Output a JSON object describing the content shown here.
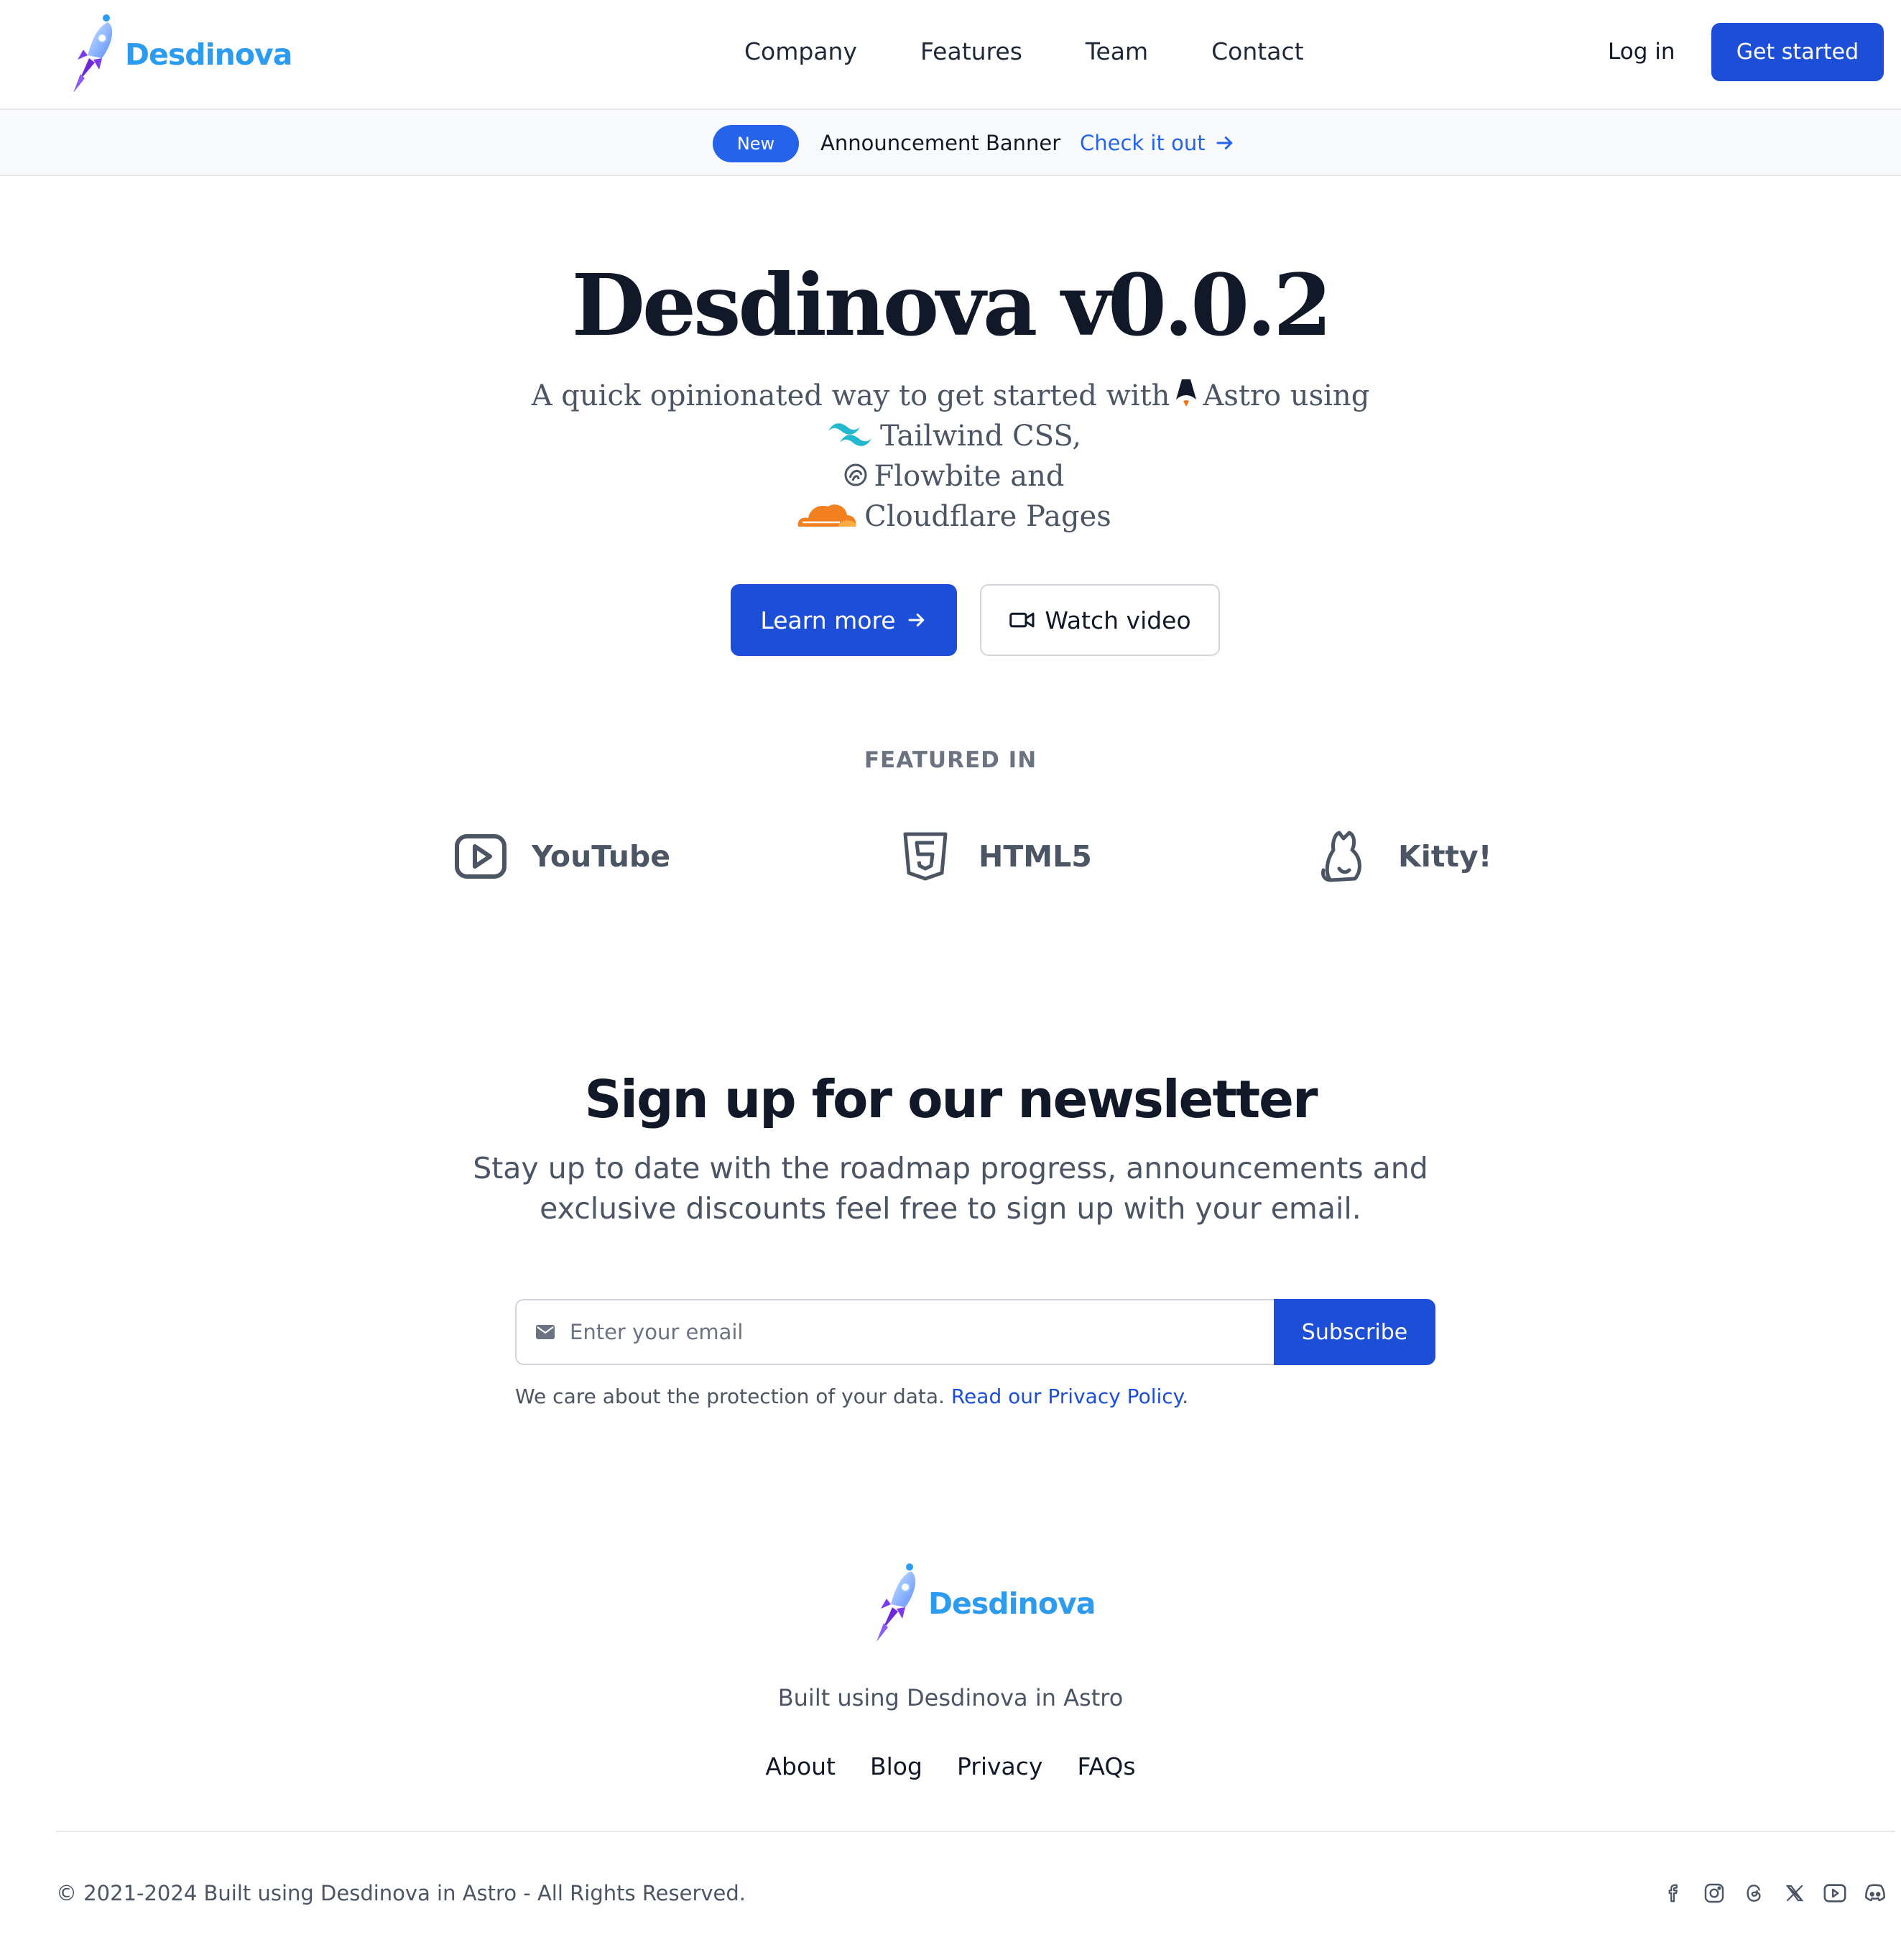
{
  "header": {
    "brand": "Desdinova",
    "nav": [
      "Company",
      "Features",
      "Team",
      "Contact"
    ],
    "login": "Log in",
    "cta": "Get started"
  },
  "banner": {
    "badge": "New",
    "text": "Announcement Banner",
    "link": "Check it out"
  },
  "hero": {
    "title": "Desdinova v0.0.2",
    "line1_pre": "A quick opinionated way to get started with",
    "line1_post": "Astro using",
    "line2": "Tailwind CSS,",
    "line3": "Flowbite and",
    "line4": "Cloudflare Pages",
    "learn_more": "Learn more",
    "watch_video": "Watch video",
    "icons": [
      "astro-icon",
      "tailwind-icon",
      "flowbite-icon",
      "cloudflare-icon",
      "arrow-right-icon",
      "video-camera-icon"
    ]
  },
  "featured": {
    "title": "FEATURED IN",
    "items": [
      {
        "label": "YouTube",
        "icon": "youtube-icon"
      },
      {
        "label": "HTML5",
        "icon": "html5-icon"
      },
      {
        "label": "Kitty!",
        "icon": "cat-icon"
      }
    ]
  },
  "newsletter": {
    "title": "Sign up for our newsletter",
    "description": "Stay up to date with the roadmap progress, announcements and exclusive discounts feel free to sign up with your email.",
    "email_placeholder": "Enter your email",
    "subscribe": "Subscribe",
    "privacy_text": "We care about the protection of your data.",
    "privacy_link": "Read our Privacy Policy",
    "privacy_end": "."
  },
  "footer": {
    "brand": "Desdinova",
    "tagline": "Built using Desdinova in Astro",
    "links": [
      "About",
      "Blog",
      "Privacy",
      "FAQs"
    ],
    "copyright": "© 2021-2024 Built using Desdinova in Astro - All Rights Reserved.",
    "socials": [
      "facebook-icon",
      "instagram-icon",
      "threads-icon",
      "x-icon",
      "youtube-icon",
      "discord-icon"
    ]
  },
  "colors": {
    "primary": "#1d4ed8",
    "badge": "#2563eb",
    "brand_text": "#2d9cf0",
    "heading": "#111827",
    "muted": "#4b5563"
  }
}
